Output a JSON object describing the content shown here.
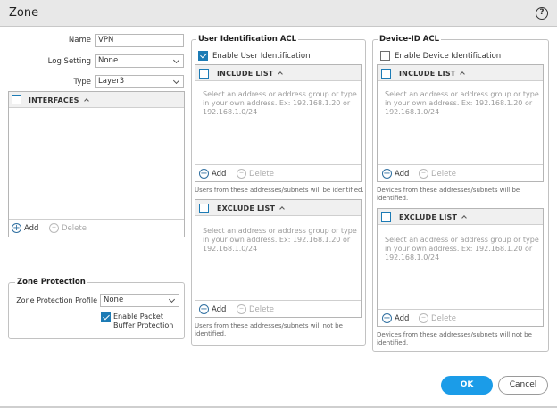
{
  "dialog": {
    "title": "Zone",
    "help_icon_glyph": "?"
  },
  "form": {
    "name_label": "Name",
    "name_value": "VPN",
    "log_setting_label": "Log Setting",
    "log_setting_value": "None",
    "type_label": "Type",
    "type_value": "Layer3"
  },
  "interfaces": {
    "header": "INTERFACES",
    "add_label": "Add",
    "delete_label": "Delete"
  },
  "zone_protection": {
    "title": "Zone Protection",
    "profile_label": "Zone Protection Profile",
    "profile_value": "None",
    "packet_buffer_label_line1": "Enable Packet",
    "packet_buffer_label_line2": "Buffer Protection",
    "packet_buffer_checked": true
  },
  "user_id_acl": {
    "title": "User Identification ACL",
    "enable_label": "Enable User Identification",
    "enable_checked": true,
    "include": {
      "header": "INCLUDE LIST",
      "placeholder_line1": "Select an address or address group or type",
      "placeholder_line2": "in your own address. Ex: 192.168.1.20 or",
      "placeholder_line3": "192.168.1.0/24",
      "add_label": "Add",
      "delete_label": "Delete",
      "note": "Users from these addresses/subnets will be identified."
    },
    "exclude": {
      "header": "EXCLUDE LIST",
      "placeholder_line1": "Select an address or address group or type",
      "placeholder_line2": "in your own address. Ex: 192.168.1.20 or",
      "placeholder_line3": "192.168.1.0/24",
      "add_label": "Add",
      "delete_label": "Delete",
      "note_line1": "Users from these addresses/subnets will not be",
      "note_line2": "identified."
    }
  },
  "device_id_acl": {
    "title": "Device-ID ACL",
    "enable_label": "Enable Device Identification",
    "enable_checked": false,
    "include": {
      "header": "INCLUDE LIST",
      "placeholder_line1": "Select an address or address group or type",
      "placeholder_line2": "in your own address. Ex: 192.168.1.20 or",
      "placeholder_line3": "192.168.1.0/24",
      "add_label": "Add",
      "delete_label": "Delete",
      "note_line1": "Devices from these addresses/subnets will be",
      "note_line2": "identified."
    },
    "exclude": {
      "header": "EXCLUDE LIST",
      "placeholder_line1": "Select an address or address group or type",
      "placeholder_line2": "in your own address. Ex: 192.168.1.20 or",
      "placeholder_line3": "192.168.1.0/24",
      "add_label": "Add",
      "delete_label": "Delete",
      "note_line1": "Devices from these addresses/subnets will not be",
      "note_line2": "identified."
    }
  },
  "buttons": {
    "ok_label": "OK",
    "cancel_label": "Cancel"
  },
  "colors": {
    "accent": "#1b9ce8",
    "checkbox": "#1c7bb5"
  }
}
